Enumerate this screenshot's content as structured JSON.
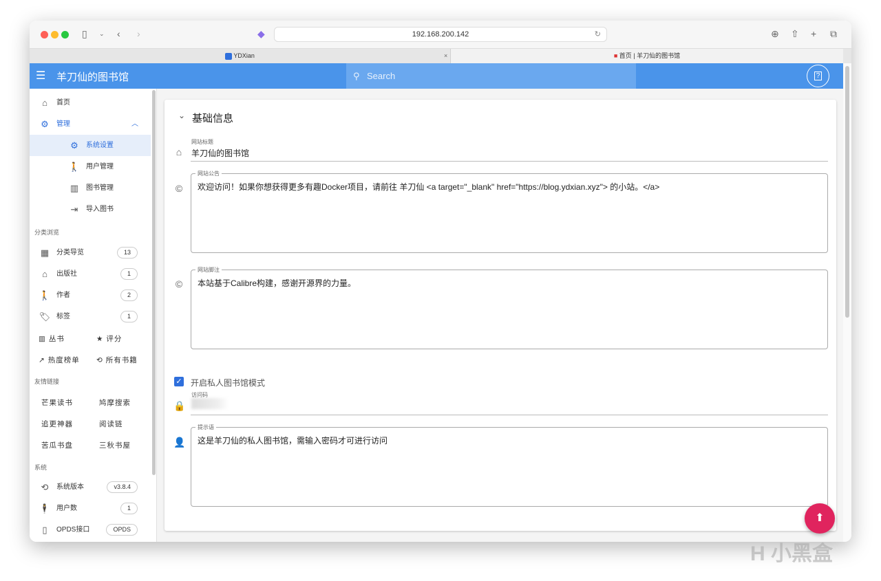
{
  "browser": {
    "url": "192.168.200.142",
    "tabs": [
      {
        "label": "YDXian"
      },
      {
        "label": "首页 | 羊刀仙的图书馆"
      }
    ],
    "close_tab": "×"
  },
  "appbar": {
    "title": "羊刀仙的图书馆",
    "search_placeholder": "Search",
    "help": "?"
  },
  "sidebar": {
    "home": "首页",
    "admin": "管理",
    "admin_items": [
      {
        "label": "系统设置",
        "icon": "gear-icon"
      },
      {
        "label": "用户管理",
        "icon": "person-icon"
      },
      {
        "label": "图书管理",
        "icon": "books-icon"
      },
      {
        "label": "导入图书",
        "icon": "import-icon"
      }
    ],
    "browse_title": "分类浏览",
    "browse_items": [
      {
        "label": "分类导览",
        "count": "13"
      },
      {
        "label": "出版社",
        "count": "1"
      },
      {
        "label": "作者",
        "count": "2"
      },
      {
        "label": "标签",
        "count": "1"
      }
    ],
    "series": "丛书",
    "rating": "评分",
    "hot": "热度榜单",
    "all_books": "所有书籍",
    "links_title": "友情链接",
    "links": [
      "芒果读书",
      "鸠摩搜索",
      "追更神器",
      "阅读链",
      "苦瓜书盘",
      "三秋书屋"
    ],
    "system_title": "系统",
    "system_items": [
      {
        "label": "系统版本",
        "value": "v3.8.4"
      },
      {
        "label": "用户数",
        "value": "1"
      },
      {
        "label": "OPDS接口",
        "value": "OPDS"
      }
    ]
  },
  "form": {
    "section": "基础信息",
    "site_title_label": "网站标题",
    "site_title": "羊刀仙的图书馆",
    "notice_label": "网站公告",
    "notice": "欢迎访问！如果你想获得更多有趣Docker项目，请前往 羊刀仙 <a target=\"_blank\" href=\"https://blog.ydxian.xyz\"> 的小站。</a>",
    "footer_label": "网站脚注",
    "footer": "本站基于Calibre构建，感谢开源界的力量。",
    "private_mode": "开启私人图书馆模式",
    "private_checked": true,
    "code_label": "访问码",
    "hint_label": "提示语",
    "hint": "这是羊刀仙的私人图书馆，需输入密码才可进行访问"
  },
  "colors": {
    "primary": "#4a94ea",
    "fab": "#e0245e"
  },
  "watermark": "小黑盒"
}
